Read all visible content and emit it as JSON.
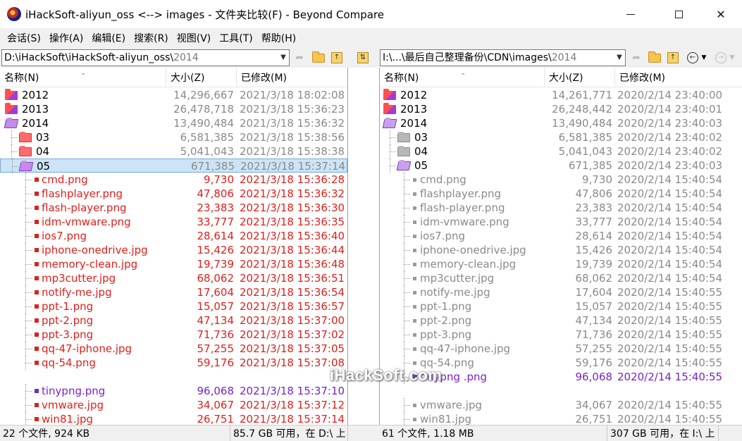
{
  "window": {
    "title": "iHackSoft-aliyun_oss <--> images - 文件夹比较(F) - Beyond Compare",
    "buttons": {
      "minimize": "",
      "maximize": "",
      "close": "✕"
    }
  },
  "menu": [
    "会话(S)",
    "操作(A)",
    "编辑(E)",
    "搜索(R)",
    "视图(V)",
    "工具(T)",
    "帮助(H)"
  ],
  "left_path": {
    "main": "D:\\iHackSoft\\iHackSoft-aliyun_oss\\",
    "tail": "2014"
  },
  "right_path": {
    "main": "I:\\...\\最后自己整理备份\\CDN\\images\\",
    "tail": "2014"
  },
  "columns": {
    "name": "名称(N)",
    "size": "大小(Z)",
    "modified": "已修改(M)"
  },
  "left_rows": [
    {
      "kind": "folder",
      "icon": "mixed",
      "name": "2012",
      "size": "14,296,667",
      "date": "2021/3/18 18:02:08",
      "color": "gray",
      "indent": 0
    },
    {
      "kind": "folder",
      "icon": "mixed",
      "name": "2013",
      "size": "26,478,718",
      "date": "2021/3/18 15:36:23",
      "color": "gray",
      "indent": 0
    },
    {
      "kind": "folder",
      "icon": "open",
      "name": "2014",
      "size": "13,490,484",
      "date": "2021/3/18 15:36:32",
      "color": "gray",
      "indent": 0
    },
    {
      "kind": "folder",
      "icon": "red",
      "name": "03",
      "size": "6,581,385",
      "date": "2021/3/18 15:38:56",
      "color": "gray",
      "indent": 1
    },
    {
      "kind": "folder",
      "icon": "red",
      "name": "04",
      "size": "5,041,043",
      "date": "2021/3/18 15:38:38",
      "color": "gray",
      "indent": 1
    },
    {
      "kind": "folder",
      "icon": "open",
      "name": "05",
      "size": "671,385",
      "date": "2021/3/18 15:37:14",
      "color": "gray",
      "indent": 1,
      "selected": true
    },
    {
      "kind": "file",
      "name": "cmd.png",
      "size": "9,730",
      "date": "2021/3/18 15:36:28",
      "color": "red",
      "indent": 2
    },
    {
      "kind": "file",
      "name": "flashplayer.png",
      "size": "47,806",
      "date": "2021/3/18 15:36:32",
      "color": "red",
      "indent": 2
    },
    {
      "kind": "file",
      "name": "flash-player.png",
      "size": "23,383",
      "date": "2021/3/18 15:36:30",
      "color": "red",
      "indent": 2
    },
    {
      "kind": "file",
      "name": "idm-vmware.png",
      "size": "33,777",
      "date": "2021/3/18 15:36:35",
      "color": "red",
      "indent": 2
    },
    {
      "kind": "file",
      "name": "ios7.png",
      "size": "28,614",
      "date": "2021/3/18 15:36:40",
      "color": "red",
      "indent": 2
    },
    {
      "kind": "file",
      "name": "iphone-onedrive.jpg",
      "size": "15,426",
      "date": "2021/3/18 15:36:44",
      "color": "red",
      "indent": 2
    },
    {
      "kind": "file",
      "name": "memory-clean.jpg",
      "size": "19,739",
      "date": "2021/3/18 15:36:48",
      "color": "red",
      "indent": 2
    },
    {
      "kind": "file",
      "name": "mp3cutter.jpg",
      "size": "68,062",
      "date": "2021/3/18 15:36:51",
      "color": "red",
      "indent": 2
    },
    {
      "kind": "file",
      "name": "notify-me.jpg",
      "size": "17,604",
      "date": "2021/3/18 15:36:54",
      "color": "red",
      "indent": 2
    },
    {
      "kind": "file",
      "name": "ppt-1.png",
      "size": "15,057",
      "date": "2021/3/18 15:36:57",
      "color": "red",
      "indent": 2
    },
    {
      "kind": "file",
      "name": "ppt-2.png",
      "size": "47,134",
      "date": "2021/3/18 15:37:00",
      "color": "red",
      "indent": 2
    },
    {
      "kind": "file",
      "name": "ppt-3.png",
      "size": "71,736",
      "date": "2021/3/18 15:37:02",
      "color": "red",
      "indent": 2
    },
    {
      "kind": "file",
      "name": "qq-47-iphone.jpg",
      "size": "57,255",
      "date": "2021/3/18 15:37:05",
      "color": "red",
      "indent": 2
    },
    {
      "kind": "file",
      "name": "qq-54.png",
      "size": "59,176",
      "date": "2021/3/18 15:37:08",
      "color": "red",
      "indent": 2
    },
    {
      "kind": "empty"
    },
    {
      "kind": "file",
      "name": "tinypng.png",
      "size": "96,068",
      "date": "2021/3/18 15:37:10",
      "color": "purple",
      "indent": 2
    },
    {
      "kind": "file",
      "name": "vmware.jpg",
      "size": "34,067",
      "date": "2021/3/18 15:37:12",
      "color": "red",
      "indent": 2
    },
    {
      "kind": "file",
      "name": "win81.jpg",
      "size": "26,751",
      "date": "2021/3/18 15:37:14",
      "color": "red",
      "indent": 2
    }
  ],
  "right_rows": [
    {
      "kind": "folder",
      "icon": "mixed",
      "name": "2012",
      "size": "14,261,771",
      "date": "2020/2/14 23:40:00",
      "color": "gray",
      "indent": 0
    },
    {
      "kind": "folder",
      "icon": "mixed",
      "name": "2013",
      "size": "26,248,442",
      "date": "2020/2/14 23:40:01",
      "color": "gray",
      "indent": 0
    },
    {
      "kind": "folder",
      "icon": "purple-open",
      "name": "2014",
      "size": "13,490,484",
      "date": "2020/2/14 23:40:03",
      "color": "gray",
      "indent": 0
    },
    {
      "kind": "folder",
      "icon": "gray",
      "name": "03",
      "size": "6,581,385",
      "date": "2020/2/14 23:40:02",
      "color": "gray",
      "indent": 1
    },
    {
      "kind": "folder",
      "icon": "gray",
      "name": "04",
      "size": "5,041,043",
      "date": "2020/2/14 23:40:02",
      "color": "gray",
      "indent": 1
    },
    {
      "kind": "folder",
      "icon": "purple-open",
      "name": "05",
      "size": "671,385",
      "date": "2020/2/14 23:40:03",
      "color": "gray",
      "indent": 1
    },
    {
      "kind": "file",
      "name": "cmd.png",
      "size": "9,730",
      "date": "2020/2/14 15:40:54",
      "color": "gray",
      "indent": 2
    },
    {
      "kind": "file",
      "name": "flashplayer.png",
      "size": "47,806",
      "date": "2020/2/14 15:40:54",
      "color": "gray",
      "indent": 2
    },
    {
      "kind": "file",
      "name": "flash-player.png",
      "size": "23,383",
      "date": "2020/2/14 15:40:54",
      "color": "gray",
      "indent": 2
    },
    {
      "kind": "file",
      "name": "idm-vmware.png",
      "size": "33,777",
      "date": "2020/2/14 15:40:54",
      "color": "gray",
      "indent": 2
    },
    {
      "kind": "file",
      "name": "ios7.png",
      "size": "28,614",
      "date": "2020/2/14 15:40:54",
      "color": "gray",
      "indent": 2
    },
    {
      "kind": "file",
      "name": "iphone-onedrive.jpg",
      "size": "15,426",
      "date": "2020/2/14 15:40:54",
      "color": "gray",
      "indent": 2
    },
    {
      "kind": "file",
      "name": "memory-clean.jpg",
      "size": "19,739",
      "date": "2020/2/14 15:40:54",
      "color": "gray",
      "indent": 2
    },
    {
      "kind": "file",
      "name": "mp3cutter.jpg",
      "size": "68,062",
      "date": "2020/2/14 15:40:54",
      "color": "gray",
      "indent": 2
    },
    {
      "kind": "file",
      "name": "notify-me.jpg",
      "size": "17,604",
      "date": "2020/2/14 15:40:55",
      "color": "gray",
      "indent": 2
    },
    {
      "kind": "file",
      "name": "ppt-1.png",
      "size": "15,057",
      "date": "2020/2/14 15:40:55",
      "color": "gray",
      "indent": 2
    },
    {
      "kind": "file",
      "name": "ppt-2.png",
      "size": "47,134",
      "date": "2020/2/14 15:40:55",
      "color": "gray",
      "indent": 2
    },
    {
      "kind": "file",
      "name": "ppt-3.png",
      "size": "71,736",
      "date": "2020/2/14 15:40:55",
      "color": "gray",
      "indent": 2
    },
    {
      "kind": "file",
      "name": "qq-47-iphone.jpg",
      "size": "57,255",
      "date": "2020/2/14 15:40:55",
      "color": "gray",
      "indent": 2
    },
    {
      "kind": "file",
      "name": "qq-54.png",
      "size": "59,176",
      "date": "2020/2/14 15:40:55",
      "color": "gray",
      "indent": 2
    },
    {
      "kind": "file",
      "name": "tinypng .png",
      "size": "96,068",
      "date": "2020/2/14 15:40:55",
      "color": "purple",
      "indent": 2
    },
    {
      "kind": "empty"
    },
    {
      "kind": "file",
      "name": "vmware.jpg",
      "size": "34,067",
      "date": "2020/2/14 15:40:55",
      "color": "gray",
      "indent": 2
    },
    {
      "kind": "file",
      "name": "win81.jpg",
      "size": "26,751",
      "date": "2020/2/14 15:40:55",
      "color": "gray",
      "indent": 2
    }
  ],
  "watermark": "iHackSoft.com",
  "status": {
    "left_files": "22 个文件, 924 KB",
    "left_free": "85.7 GB 可用，在 D:\\ 上",
    "right_files": "61 个文件, 1.18 MB",
    "right_free": "307 GB 可用，在 I:\\ 上"
  },
  "colors": {
    "diff_red": "#e0201b",
    "diff_purple": "#7a1fd1",
    "same_gray": "#8a8a8a",
    "selection": "#cce4f7"
  }
}
